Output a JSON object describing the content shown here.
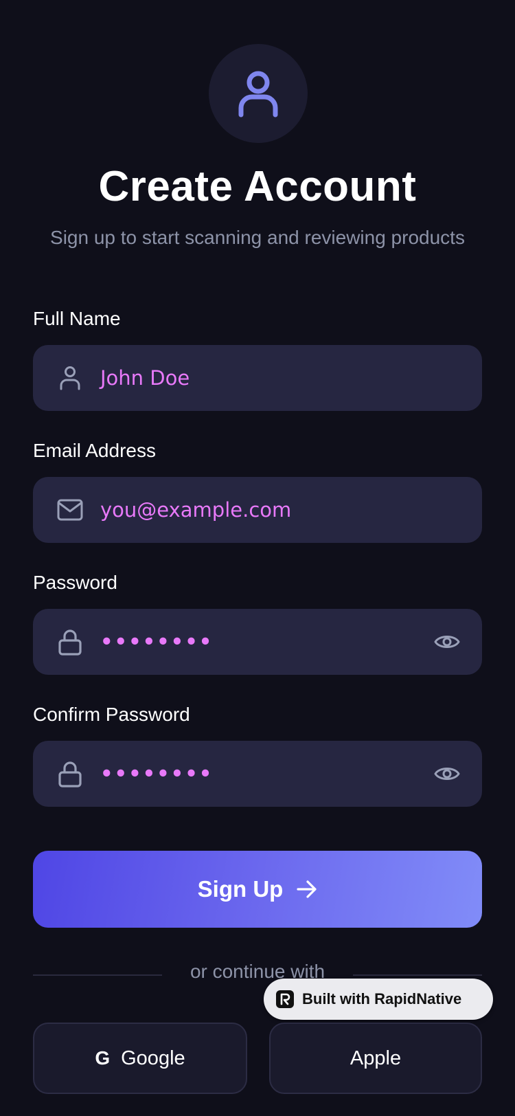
{
  "header": {
    "avatar_icon": "user-icon",
    "title": "Create Account",
    "subtitle": "Sign up to start scanning and reviewing products"
  },
  "form": {
    "full_name": {
      "label": "Full Name",
      "value": "John Doe",
      "icon": "user-icon"
    },
    "email": {
      "label": "Email Address",
      "value": "you@example.com",
      "icon": "mail-icon"
    },
    "password": {
      "label": "Password",
      "value": "••••••••",
      "icon": "lock-icon",
      "toggle_icon": "eye-icon"
    },
    "confirm_password": {
      "label": "Confirm Password",
      "value": "••••••••",
      "icon": "lock-icon",
      "toggle_icon": "eye-icon"
    }
  },
  "actions": {
    "signup_label": "Sign Up",
    "signup_icon": "arrow-right-icon",
    "divider_text": "or continue with",
    "google_glyph": "G",
    "google_label": "Google",
    "apple_label": "Apple"
  },
  "badge": {
    "label": "Built with RapidNative"
  },
  "colors": {
    "background": "#0f0f1a",
    "field_background": "#262641",
    "accent": "#6366f1",
    "value_text": "#e879f9",
    "muted_text": "#8d93a8"
  }
}
